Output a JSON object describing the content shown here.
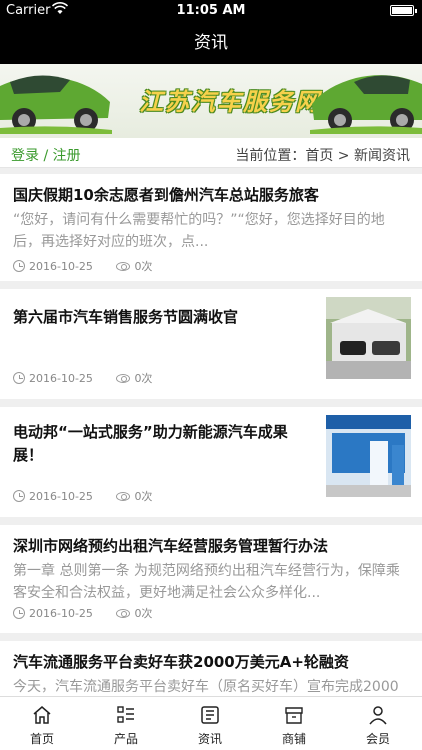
{
  "status": {
    "carrier": "Carrier",
    "time": "11:05 AM"
  },
  "nav": {
    "title": "资讯"
  },
  "banner": {
    "brand_text": "江苏汽车服务网"
  },
  "location": {
    "login": "登录 / 注册",
    "breadcrumb": "当前位置：首页 > 新闻资讯"
  },
  "news": [
    {
      "title": "国庆假期10余志愿者到儋州汽车总站服务旅客",
      "summary": "“您好，请问有什么需要帮忙的吗？”“您好，您选择好目的地后，再选择好对应的班次，点...",
      "date": "2016-10-25",
      "views": "0次"
    },
    {
      "title": "第六届市汽车销售服务节圆满收官",
      "summary": "",
      "date": "2016-10-25",
      "views": "0次"
    },
    {
      "title": "电动邦“一站式服务”助力新能源汽车成果展！",
      "summary": "",
      "date": "2016-10-25",
      "views": "0次"
    },
    {
      "title": "深圳市网络预约出租汽车经营服务管理暂行办法",
      "summary": "第一章 总则第一条 为规范网络预约出租汽车经营行为，保障乘客安全和合法权益，更好地满足社会公众多样化...",
      "date": "2016-10-25",
      "views": "0次"
    },
    {
      "title": "汽车流通服务平台卖好车获2000万美元A+轮融资",
      "summary": "今天，汽车流通服务平台卖好车（原名买好车）宣布完成2000",
      "date": "",
      "views": ""
    }
  ],
  "tabs": [
    {
      "label": "首页",
      "icon": "home-icon"
    },
    {
      "label": "产品",
      "icon": "list-icon"
    },
    {
      "label": "资讯",
      "icon": "news-icon"
    },
    {
      "label": "商铺",
      "icon": "store-icon"
    },
    {
      "label": "会员",
      "icon": "user-icon"
    }
  ],
  "colors": {
    "accent_green": "#3a9a2c",
    "nav_bg": "#000000"
  }
}
